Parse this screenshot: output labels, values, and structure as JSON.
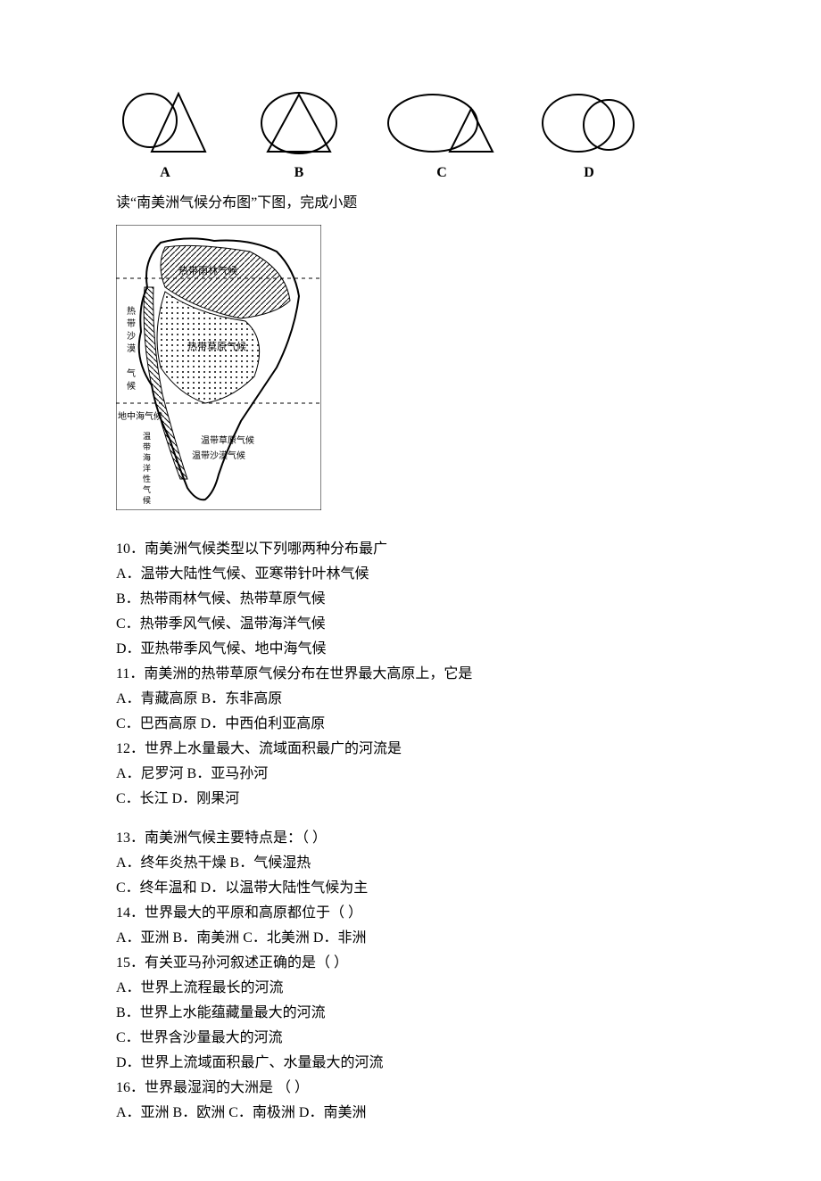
{
  "diagrams": {
    "labels": [
      "A",
      "B",
      "C",
      "D"
    ]
  },
  "intro": "读“南美洲气候分布图”下图，完成小题",
  "mapLabels": {
    "tropicalRainforest": "热带雨林气候",
    "tropicalGrassland": "热带草原气候",
    "tropicalDesert": "热带沙漠",
    "mediterranean": "地中海气候",
    "temperateMaritime": "温带海洋性气候",
    "temperateGrassland": "温带草原气候",
    "temperateDesert": "温带沙漠气候"
  },
  "q10": {
    "stem": "10．南美洲气候类型以下列哪两种分布最广",
    "a": "A．温带大陆性气候、亚寒带针叶林气候",
    "b": "B．热带雨林气候、热带草原气候",
    "c": "C．热带季风气候、温带海洋气候",
    "d": "D．亚热带季风气候、地中海气候"
  },
  "q11": {
    "stem": "11．南美洲的热带草原气候分布在世界最大高原上，它是",
    "line1": "A．青藏高原            B．东非高原",
    "line2": "C．巴西高原          D．中西伯利亚高原"
  },
  "q12": {
    "stem": "12．世界上水量最大、流域面积最广的河流是",
    "line1": "A．尼罗河        B．亚马孙河",
    "line2": "C．长江          D．刚果河"
  },
  "q13": {
    "stem": "13．南美洲气候主要特点是：（    ）",
    "line1": "A．终年炎热干燥        B．气候湿热",
    "line2": "C．终年温和            D．以温带大陆性气候为主"
  },
  "q14": {
    "stem": "14．世界最大的平原和高原都位于（    ）",
    "opts": "A．亚洲    B．南美洲    C．北美洲    D．非洲"
  },
  "q15": {
    "stem": "15．有关亚马孙河叙述正确的是（    ）",
    "a": "A．世界上流程最长的河流",
    "b": "B．世界上水能蕴藏量最大的河流",
    "c": "C．世界含沙量最大的河流",
    "d": "D．世界上流域面积最广、水量最大的河流"
  },
  "q16": {
    "stem": "16．世界最湿润的大洲是      （    ）",
    "opts": "A．亚洲       B．欧洲         C．南极洲          D．南美洲"
  }
}
